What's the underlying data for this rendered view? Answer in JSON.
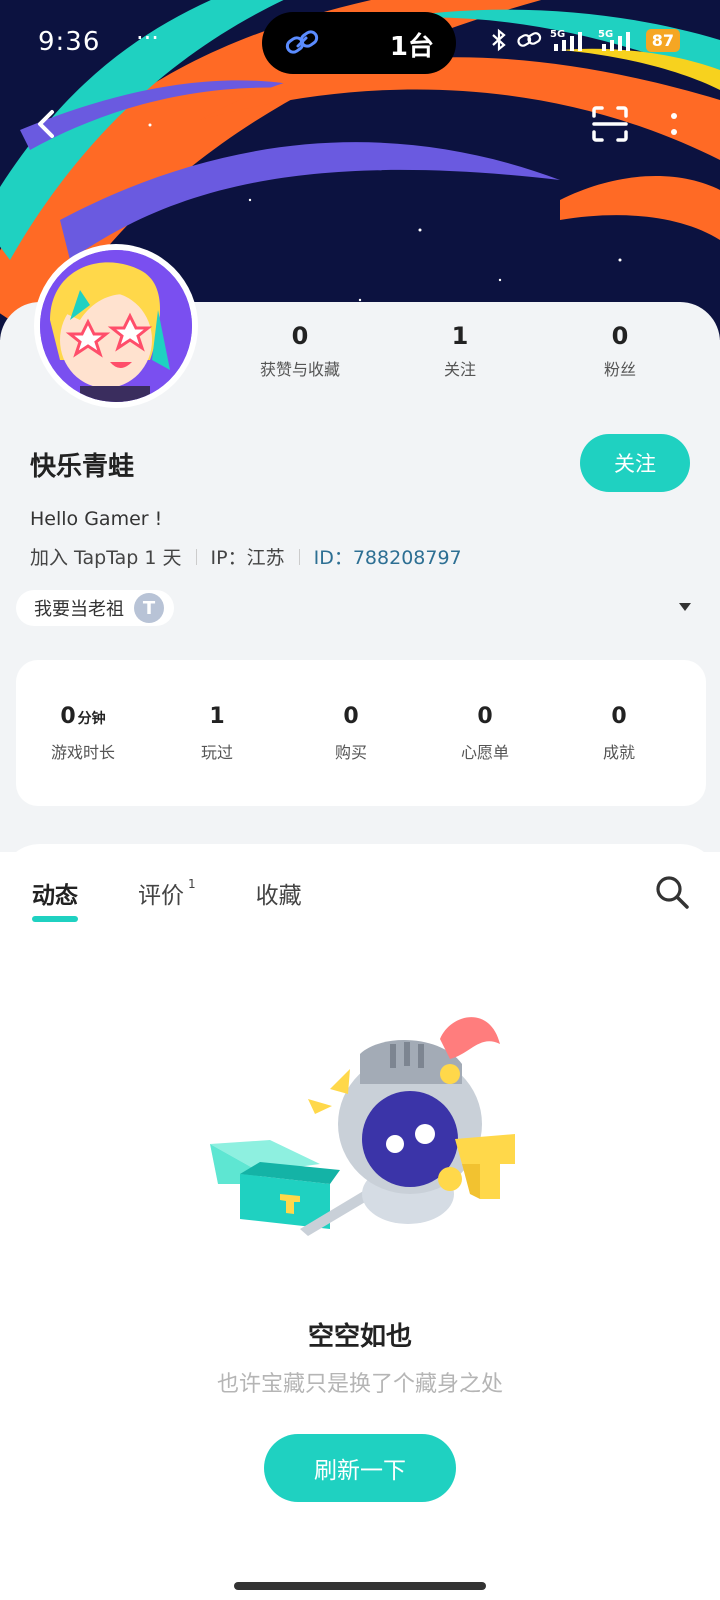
{
  "status_bar": {
    "time": "9:36",
    "notification": "··· ",
    "island_text": "1台",
    "battery": "87"
  },
  "nav": {
    "back_icon": "chevron-left-icon",
    "scan_icon": "scan-icon",
    "more_icon": "more-vertical-icon"
  },
  "profile": {
    "stats": [
      {
        "num": "0",
        "label": "获赞与收藏"
      },
      {
        "num": "1",
        "label": "关注"
      },
      {
        "num": "0",
        "label": "粉丝"
      }
    ],
    "username": "快乐青蛙",
    "follow_label": "关注",
    "bio": "Hello Gamer !",
    "joined": "加入 TapTap 1 天",
    "ip": "IP：江苏",
    "user_id": "ID：788208797",
    "badge_label": "我要当老祖",
    "badge_icon_text": "T"
  },
  "game_stats": [
    {
      "num": "0",
      "unit": "分钟",
      "label": "游戏时长"
    },
    {
      "num": "1",
      "unit": "",
      "label": "玩过"
    },
    {
      "num": "0",
      "unit": "",
      "label": "购买"
    },
    {
      "num": "0",
      "unit": "",
      "label": "心愿单"
    },
    {
      "num": "0",
      "unit": "",
      "label": "成就"
    }
  ],
  "tabs": [
    {
      "label": "动态",
      "count": ""
    },
    {
      "label": "评价",
      "count": "1"
    },
    {
      "label": "收藏",
      "count": ""
    }
  ],
  "empty": {
    "title": "空空如也",
    "subtitle": "也许宝藏只是换了个藏身之处",
    "refresh_label": "刷新一下"
  },
  "colors": {
    "accent": "#1fd1c1",
    "id_link": "#2d6f93"
  }
}
